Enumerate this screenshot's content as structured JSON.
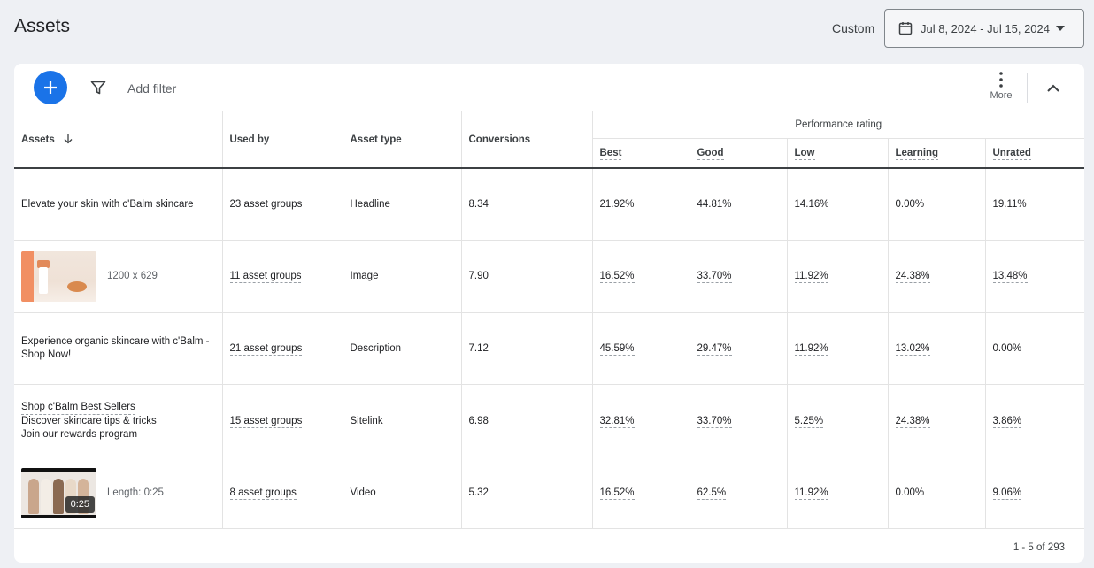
{
  "page": {
    "title": "Assets"
  },
  "date_range": {
    "label": "Custom",
    "value": "Jul 8, 2024 - Jul 15, 2024"
  },
  "toolbar": {
    "add_filter": "Add filter",
    "more": "More"
  },
  "table": {
    "headers": {
      "assets": "Assets",
      "used_by": "Used by",
      "asset_type": "Asset type",
      "conversions": "Conversions",
      "performance_rating": "Performance rating",
      "best": "Best",
      "good": "Good",
      "low": "Low",
      "learning": "Learning",
      "unrated": "Unrated"
    },
    "rows": [
      {
        "asset": "Elevate your skin with c'Balm skincare",
        "used_by": "23 asset groups",
        "type": "Headline",
        "conversions": "8.34",
        "best": "21.92%",
        "good": "44.81%",
        "low": "14.16%",
        "learning": "0.00%",
        "unrated": "19.11%"
      },
      {
        "asset_meta": "1200 x 629",
        "used_by": "11 asset groups",
        "type": "Image",
        "conversions": "7.90",
        "best": "16.52%",
        "good": "33.70%",
        "low": "11.92%",
        "learning": "24.38%",
        "unrated": "13.48%"
      },
      {
        "asset": "Experience organic skincare with c'Balm - Shop Now!",
        "used_by": "21 asset groups",
        "type": "Description",
        "conversions": "7.12",
        "best": "45.59%",
        "good": "29.47%",
        "low": "11.92%",
        "learning": "13.02%",
        "unrated": "0.00%"
      },
      {
        "asset_lines": [
          "Shop c'Balm Best Sellers",
          "Discover skincare tips & tricks",
          "Join our rewards program"
        ],
        "used_by": "15 asset groups",
        "type": "Sitelink",
        "conversions": "6.98",
        "best": "32.81%",
        "good": "33.70%",
        "low": "5.25%",
        "learning": "24.38%",
        "unrated": "3.86%"
      },
      {
        "asset_meta": "Length: 0:25",
        "video_length": "0:25",
        "used_by": "8 asset groups",
        "type": "Video",
        "conversions": "5.32",
        "best": "16.52%",
        "good": "62.5%",
        "low": "11.92%",
        "learning": "0.00%",
        "unrated": "9.06%"
      }
    ]
  },
  "pagination": "1 - 5 of 293",
  "colors": {
    "accent": "#1a73e8",
    "background": "#eef0f4"
  }
}
